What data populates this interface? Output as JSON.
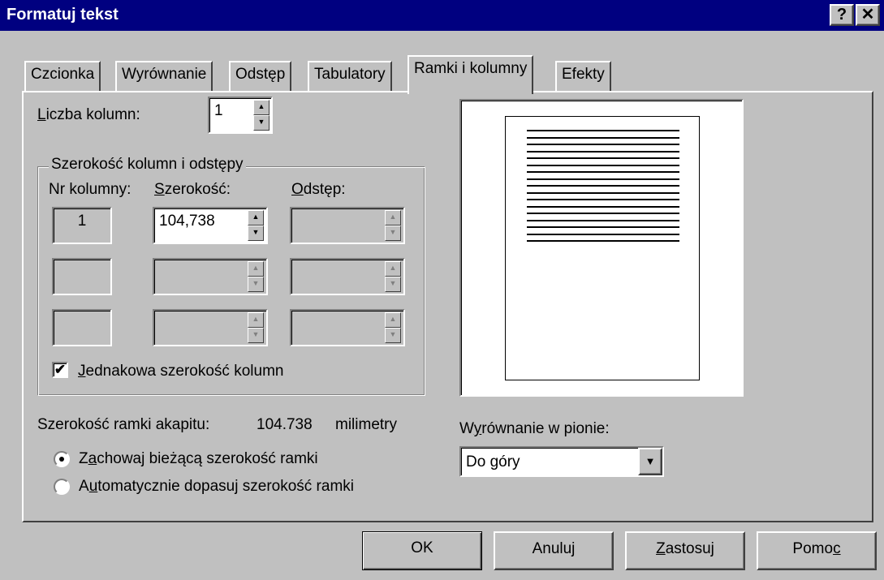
{
  "window": {
    "title": "Formatuj tekst",
    "help_button": "?",
    "close_button": "✕"
  },
  "tabs": [
    {
      "label": "Czcionka",
      "active": false
    },
    {
      "label": "Wyrównanie",
      "active": false
    },
    {
      "label": "Odstęp",
      "active": false
    },
    {
      "label": "Tabulatory",
      "active": false
    },
    {
      "label": "Ramki i kolumny",
      "active": true
    },
    {
      "label": "Efekty",
      "active": false
    }
  ],
  "columns": {
    "count_label_first": "L",
    "count_label_rest": "iczba kolumn:",
    "count_value": "1"
  },
  "width_group": {
    "title": "Szerokość kolumn i odstępy",
    "col_header": "Nr kolumny:",
    "width_header_first": "S",
    "width_header_rest": "zerokość:",
    "spacing_header_first": "O",
    "spacing_header_rest": "dstęp:",
    "rows": [
      {
        "number": "1",
        "width": "104,738",
        "spacing": ""
      },
      {
        "number": "",
        "width": "",
        "spacing": ""
      },
      {
        "number": "",
        "width": "",
        "spacing": ""
      }
    ],
    "equal_width_checked": true,
    "equal_width_first": "J",
    "equal_width_rest": "ednakowa szerokość kolumn"
  },
  "frame": {
    "width_label": "Szerokość ramki akapitu:",
    "width_value": "104.738",
    "width_unit": "milimetry",
    "option_keep_pre": "Z",
    "option_keep_u": "a",
    "option_keep_rest": "chowaj bieżącą szerokość ramki",
    "option_auto_pre": "A",
    "option_auto_u": "u",
    "option_auto_rest": "tomatycznie dopasuj szerokość ramki",
    "selected": "keep"
  },
  "vertical": {
    "label_pre": "W",
    "label_u": "y",
    "label_rest": "równanie w pionie:",
    "value": "Do góry"
  },
  "buttons": {
    "ok": "OK",
    "cancel": "Anuluj",
    "apply_u": "Z",
    "apply_rest": "astosuj",
    "help_pre": "Pomo",
    "help_u": "c"
  },
  "preview": {
    "line_count": 17
  }
}
